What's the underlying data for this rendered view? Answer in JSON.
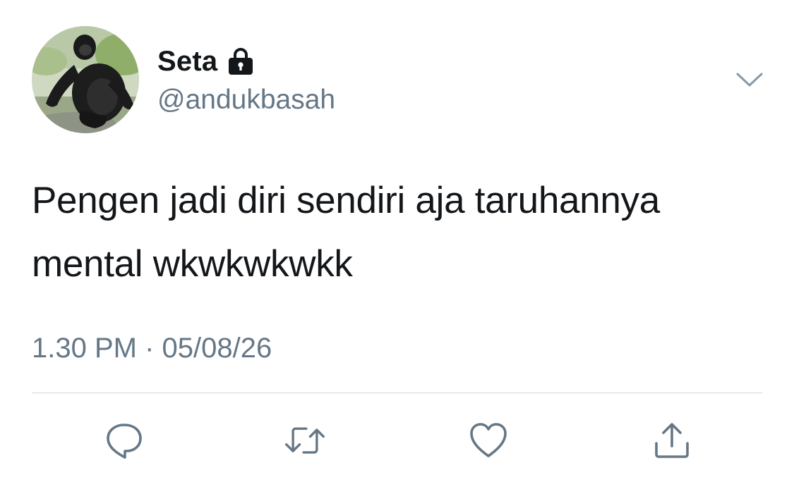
{
  "tweet": {
    "display_name": "Seta",
    "handle": "@andukbasah",
    "text_line1": "Pengen jadi diri sendiri aja taruhannya",
    "text_line2": "mental wkwkwkwkk",
    "time": "1.30 PM",
    "separator": "·",
    "date": "05/08/26"
  },
  "icons": {
    "protected": "lock-icon",
    "menu": "chevron-down-icon",
    "reply": "reply-bubble-icon",
    "retweet": "retweet-icon",
    "like": "heart-icon",
    "share": "share-upload-icon"
  },
  "colors": {
    "primary_text": "#14171a",
    "secondary_text": "#657786",
    "divider": "#ccd6dd"
  }
}
